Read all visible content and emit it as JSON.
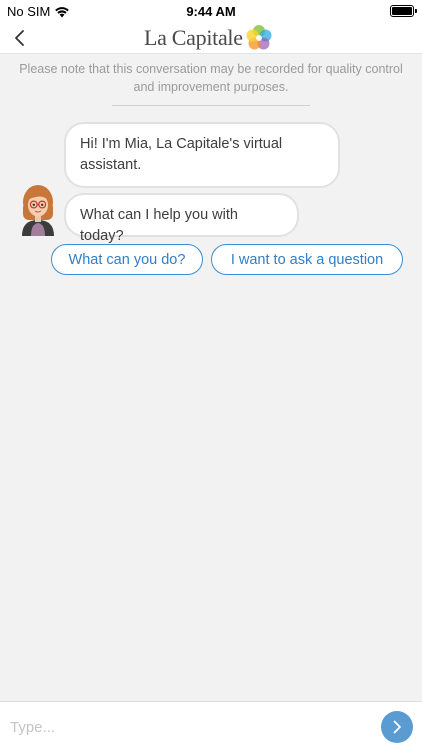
{
  "status_bar": {
    "carrier": "No SIM",
    "time": "9:44 AM",
    "battery_level": 1.0
  },
  "header": {
    "brand_name": "La Capitale",
    "back_icon": "chevron-left-icon",
    "logo_icon": "flower-logo-icon"
  },
  "notice": {
    "text": "Please note that this conversation may be recorded for quality control and improvement purposes."
  },
  "chat": {
    "messages": [
      {
        "sender": "bot",
        "text": "Hi! I'm Mia, La Capitale's virtual assistant."
      },
      {
        "sender": "bot",
        "text": "What can I help you with today?"
      }
    ],
    "quick_replies": [
      {
        "label": "What can you do?"
      },
      {
        "label": "I want to ask a question"
      }
    ]
  },
  "composer": {
    "placeholder": "Type...",
    "value": "",
    "send_icon": "chevron-right-icon"
  },
  "colors": {
    "accent": "#3a8dd6",
    "send_button": "#5a9bd2",
    "background": "#f2f2f2",
    "bubble_border": "#e1e1e1"
  }
}
